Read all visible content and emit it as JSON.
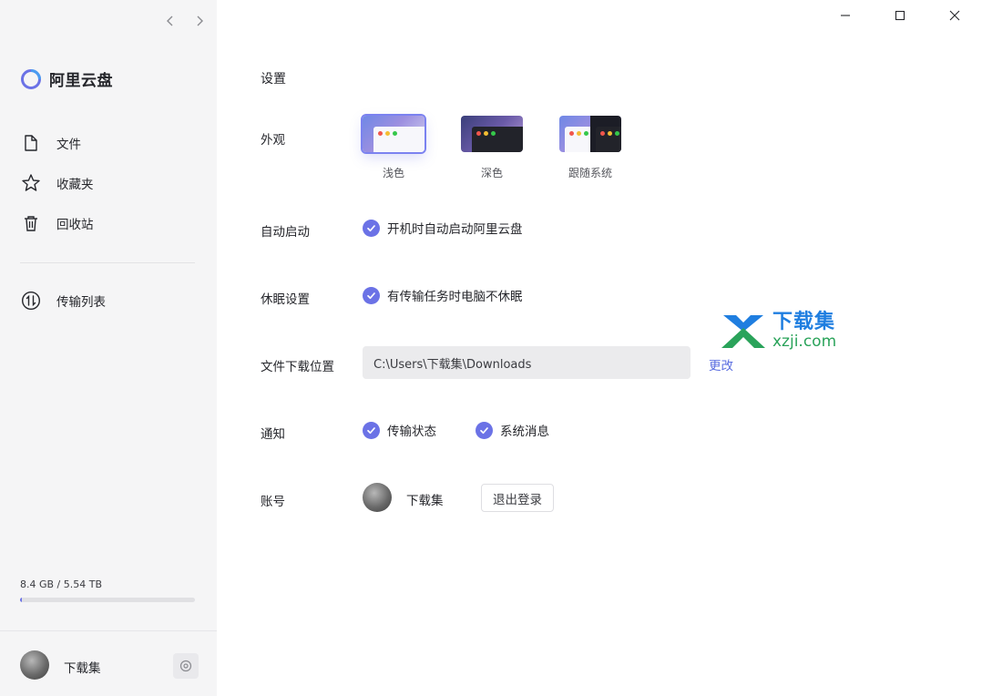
{
  "app": {
    "name": "阿里云盘"
  },
  "sidebar": {
    "items": [
      {
        "label": "文件",
        "icon": "file-icon"
      },
      {
        "label": "收藏夹",
        "icon": "star-icon"
      },
      {
        "label": "回收站",
        "icon": "trash-icon"
      }
    ],
    "transfer": {
      "label": "传输列表",
      "icon": "transfer-icon"
    },
    "storage": {
      "text": "8.4 GB / 5.54 TB",
      "used_fraction": 0.0015
    },
    "user": {
      "name": "下载集"
    }
  },
  "settings": {
    "title": "设置",
    "appearance": {
      "label": "外观",
      "options": [
        {
          "label": "浅色",
          "selected": true
        },
        {
          "label": "深色",
          "selected": false
        },
        {
          "label": "跟随系统",
          "selected": false
        }
      ]
    },
    "autostart": {
      "label": "自动启动",
      "option": "开机时自动启动阿里云盘",
      "checked": true
    },
    "sleep": {
      "label": "休眠设置",
      "option": "有传输任务时电脑不休眠",
      "checked": true
    },
    "download": {
      "label": "文件下载位置",
      "path": "C:\\Users\\下载集\\Downloads",
      "change": "更改"
    },
    "notify": {
      "label": "通知",
      "options": [
        "传输状态",
        "系统消息"
      ]
    },
    "account": {
      "label": "账号",
      "name": "下载集",
      "logout": "退出登录"
    }
  },
  "watermark": {
    "cn": "下载集",
    "en": "xzji.com"
  },
  "colors": {
    "accent": "#6b72e6",
    "link": "#5a6de0",
    "sidebar_bg": "#f5f5f6"
  }
}
